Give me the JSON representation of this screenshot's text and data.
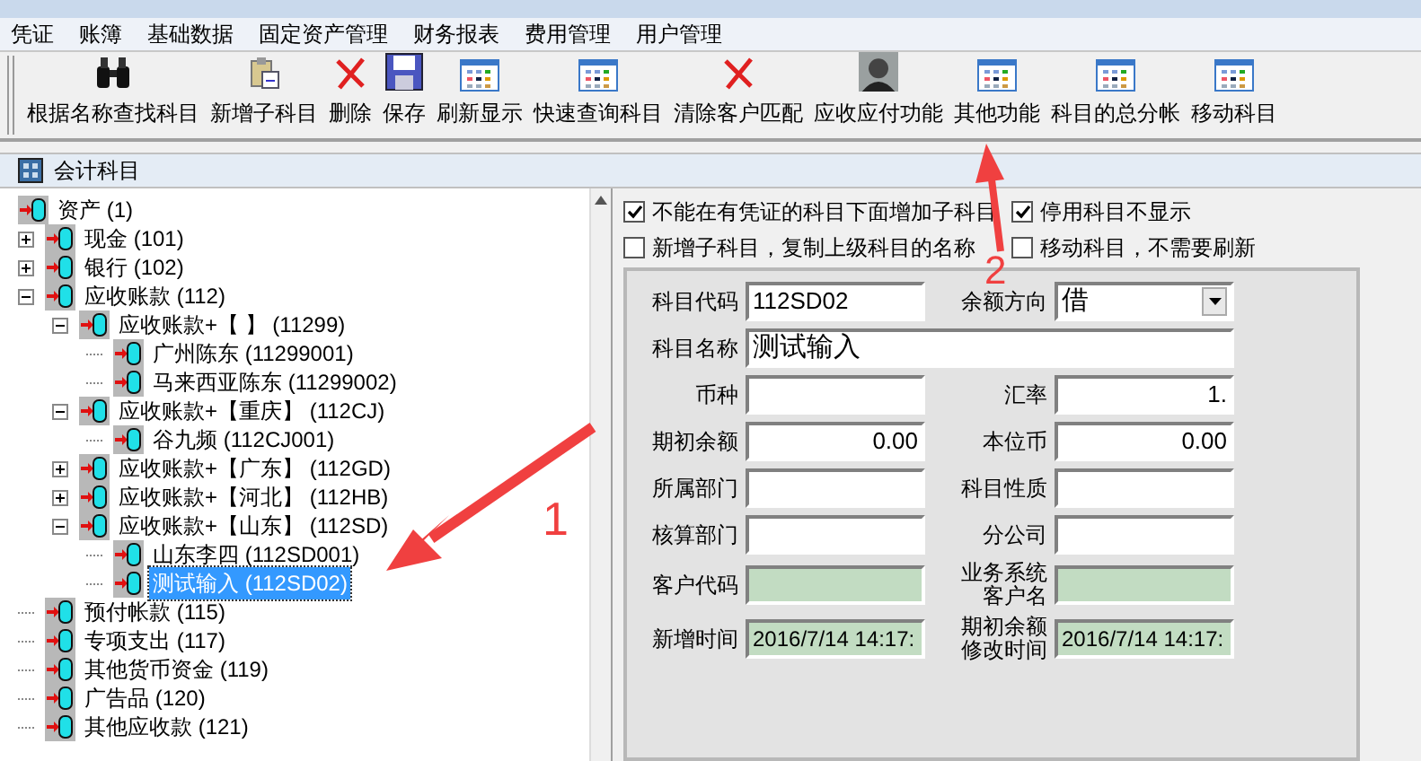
{
  "menu": [
    "凭证",
    "账簿",
    "基础数据",
    "固定资产管理",
    "财务报表",
    "费用管理",
    "用户管理"
  ],
  "toolbar": [
    {
      "label": "根据名称查找科目",
      "kind": "find"
    },
    {
      "label": "新增子科目",
      "kind": "add"
    },
    {
      "label": "删除",
      "kind": "delete"
    },
    {
      "label": "保存",
      "kind": "save"
    },
    {
      "label": "刷新显示",
      "kind": "view"
    },
    {
      "label": "快速查询科目",
      "kind": "view"
    },
    {
      "label": "清除客户匹配",
      "kind": "delete"
    },
    {
      "label": "应收应付功能",
      "kind": "person"
    },
    {
      "label": "其他功能",
      "kind": "view"
    },
    {
      "label": "科目的总分帐",
      "kind": "view"
    },
    {
      "label": "移动科目",
      "kind": "view"
    }
  ],
  "panel": {
    "title": "会计科目"
  },
  "tree": [
    {
      "label": "资产 (1)",
      "selected": false,
      "children": [
        {
          "label": "现金 (101)",
          "selected": false,
          "expanded": false
        },
        {
          "label": "银行 (102)",
          "selected": false,
          "expanded": false
        },
        {
          "label": "应收账款 (112)",
          "selected": false,
          "expanded": true,
          "children": [
            {
              "label": "应收账款+【 】 (11299)",
              "selected": false,
              "expanded": true,
              "children": [
                {
                  "label": "广州陈东 (11299001)",
                  "selected": false
                },
                {
                  "label": "马来西亚陈东 (11299002)",
                  "selected": false
                }
              ]
            },
            {
              "label": "应收账款+【重庆】 (112CJ)",
              "selected": false,
              "expanded": true,
              "children": [
                {
                  "label": "谷九频 (112CJ001)",
                  "selected": false
                }
              ]
            },
            {
              "label": "应收账款+【广东】 (112GD)",
              "selected": false,
              "expanded": false
            },
            {
              "label": "应收账款+【河北】 (112HB)",
              "selected": false,
              "expanded": false
            },
            {
              "label": "应收账款+【山东】 (112SD)",
              "selected": false,
              "expanded": true,
              "children": [
                {
                  "label": "山东李四 (112SD001)",
                  "selected": false
                },
                {
                  "label": "测试输入 (112SD02)",
                  "selected": true
                }
              ]
            }
          ]
        },
        {
          "label": "预付帐款 (115)",
          "selected": false
        },
        {
          "label": "专项支出 (117)",
          "selected": false
        },
        {
          "label": "其他货币资金 (119)",
          "selected": false
        },
        {
          "label": "广告品 (120)",
          "selected": false
        },
        {
          "label": "其他应收款 (121)",
          "selected": false
        }
      ]
    }
  ],
  "options": [
    {
      "label": "不能在有凭证的科目下面增加子科目",
      "checked": true
    },
    {
      "label": "停用科目不显示",
      "checked": true
    },
    {
      "label": "新增子科目，复制上级科目的名称",
      "checked": false
    },
    {
      "label": "移动科目，不需要刷新",
      "checked": false
    }
  ],
  "form": [
    {
      "label": "科目代码",
      "value": "112SD02",
      "kind": "text"
    },
    {
      "label": "余额方向",
      "value": "借",
      "kind": "select"
    },
    {
      "label": "科目名称",
      "value": "测试输入",
      "kind": "wide"
    },
    {
      "label": "币种",
      "kind": "text"
    },
    {
      "label": "汇率",
      "value": "1.",
      "kind": "number"
    },
    {
      "label": "期初余额",
      "value": "0.00",
      "kind": "number"
    },
    {
      "label": "本位币",
      "value": "0.00",
      "kind": "number"
    },
    {
      "label": "所属部门",
      "kind": "text"
    },
    {
      "label": "科目性质",
      "kind": "text"
    },
    {
      "label": "核算部门",
      "kind": "text"
    },
    {
      "label": "分公司",
      "kind": "text"
    },
    {
      "label": "客户代码",
      "kind": "readonly"
    },
    {
      "label": "业务系统客户名",
      "kind": "readonly"
    },
    {
      "label": "新增时间",
      "value": "2016/7/14 14:17:",
      "kind": "readonly"
    },
    {
      "label": "期初余额修改时间",
      "value": "2016/7/14 14:17:",
      "kind": "readonly"
    }
  ],
  "annotations": [
    "1",
    "2"
  ]
}
